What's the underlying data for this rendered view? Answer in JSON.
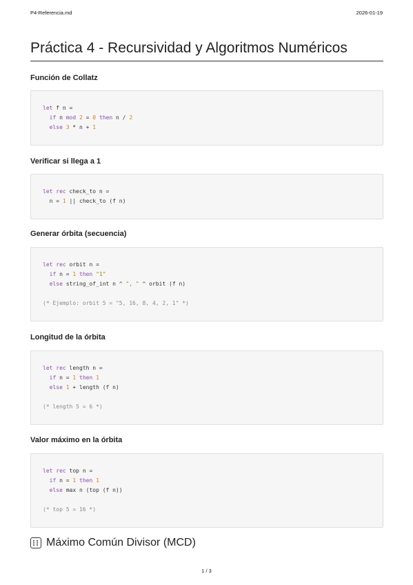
{
  "header": {
    "filename": "P4-Referencia.md",
    "date": "2026-01-19"
  },
  "title": "Práctica 4 - Recursividad y Algoritmos Numéricos",
  "sections": [
    {
      "heading": "Función de Collatz",
      "lines": [
        [
          [
            "let",
            "kw"
          ],
          [
            " f n =",
            ""
          ]
        ],
        [
          [
            "  ",
            ""
          ],
          [
            "if",
            "kw"
          ],
          [
            " n ",
            ""
          ],
          [
            "mod",
            "kw"
          ],
          [
            " ",
            ""
          ],
          [
            "2",
            "num"
          ],
          [
            " = ",
            ""
          ],
          [
            "0",
            "num"
          ],
          [
            " ",
            ""
          ],
          [
            "then",
            "kw"
          ],
          [
            " n / ",
            ""
          ],
          [
            "2",
            "num"
          ]
        ],
        [
          [
            "  ",
            ""
          ],
          [
            "else",
            "kw"
          ],
          [
            " ",
            ""
          ],
          [
            "3",
            "num"
          ],
          [
            " * n + ",
            ""
          ],
          [
            "1",
            "num"
          ]
        ]
      ]
    },
    {
      "heading": "Verificar si llega a 1",
      "lines": [
        [
          [
            "let",
            "kw"
          ],
          [
            " ",
            ""
          ],
          [
            "rec",
            "kw"
          ],
          [
            " check_to n =",
            ""
          ]
        ],
        [
          [
            "  n = ",
            ""
          ],
          [
            "1",
            "num"
          ],
          [
            " || check_to (f n)",
            ""
          ]
        ]
      ]
    },
    {
      "heading": "Generar órbita (secuencia)",
      "lines": [
        [
          [
            "let",
            "kw"
          ],
          [
            " ",
            ""
          ],
          [
            "rec",
            "kw"
          ],
          [
            " orbit n =",
            ""
          ]
        ],
        [
          [
            "  ",
            ""
          ],
          [
            "if",
            "kw"
          ],
          [
            " n = ",
            ""
          ],
          [
            "1",
            "num"
          ],
          [
            " ",
            ""
          ],
          [
            "then",
            "kw"
          ],
          [
            " ",
            ""
          ],
          [
            "\"1\"",
            "str"
          ]
        ],
        [
          [
            "  ",
            ""
          ],
          [
            "else",
            "kw"
          ],
          [
            " string_of_int n ^ ",
            ""
          ],
          [
            "\", \"",
            "str"
          ],
          [
            " ^ orbit (f n)",
            ""
          ]
        ],
        [],
        [
          [
            "(* Ejemplo: orbit 5 = \"5, 16, 8, 4, 2, 1\" *)",
            "cm"
          ]
        ]
      ]
    },
    {
      "heading": "Longitud de la órbita",
      "lines": [
        [
          [
            "let",
            "kw"
          ],
          [
            " ",
            ""
          ],
          [
            "rec",
            "kw"
          ],
          [
            " length n =",
            ""
          ]
        ],
        [
          [
            "  ",
            ""
          ],
          [
            "if",
            "kw"
          ],
          [
            " n = ",
            ""
          ],
          [
            "1",
            "num"
          ],
          [
            " ",
            ""
          ],
          [
            "then",
            "kw"
          ],
          [
            " ",
            ""
          ],
          [
            "1",
            "num"
          ]
        ],
        [
          [
            "  ",
            ""
          ],
          [
            "else",
            "kw"
          ],
          [
            " ",
            ""
          ],
          [
            "1",
            "num"
          ],
          [
            " + length (f n)",
            ""
          ]
        ],
        [],
        [
          [
            "(* length 5 = 6 *)",
            "cm"
          ]
        ]
      ]
    },
    {
      "heading": "Valor máximo en la órbita",
      "lines": [
        [
          [
            "let",
            "kw"
          ],
          [
            " ",
            ""
          ],
          [
            "rec",
            "kw"
          ],
          [
            " top n =",
            ""
          ]
        ],
        [
          [
            "  ",
            ""
          ],
          [
            "if",
            "kw"
          ],
          [
            " n = ",
            ""
          ],
          [
            "1",
            "num"
          ],
          [
            " ",
            ""
          ],
          [
            "then",
            "kw"
          ],
          [
            " ",
            ""
          ],
          [
            "1",
            "num"
          ]
        ],
        [
          [
            "  ",
            ""
          ],
          [
            "else",
            "kw"
          ],
          [
            " max n (top (f n))",
            ""
          ]
        ],
        [],
        [
          [
            "(* top 5 = 16 *)",
            "cm"
          ]
        ]
      ]
    }
  ],
  "next_heading": {
    "icon": "dice-icon",
    "text": "Máximo Común Divisor (MCD)"
  },
  "footer": {
    "page": "1 / 3"
  }
}
